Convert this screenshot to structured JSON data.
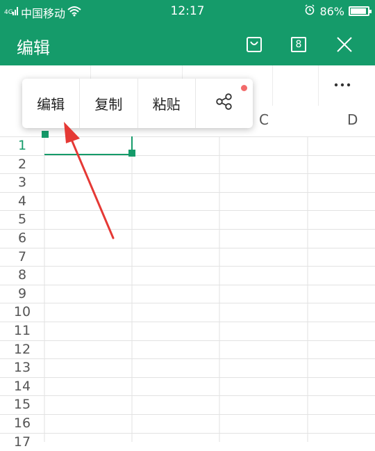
{
  "status_bar": {
    "carrier": "中国移动",
    "time": "12:17",
    "battery": "86%",
    "battery_level": 0.86
  },
  "header": {
    "title": "编辑",
    "page_count": "8"
  },
  "columns": [
    "C",
    "D"
  ],
  "rows": [
    "1",
    "2",
    "3",
    "4",
    "5",
    "6",
    "7",
    "8",
    "9",
    "10",
    "11",
    "12",
    "13",
    "14",
    "15",
    "16",
    "17"
  ],
  "active_row": "1",
  "context_menu": {
    "edit": "编辑",
    "copy": "复制",
    "paste": "粘贴"
  },
  "colors": {
    "accent": "#159b6a",
    "arrow": "#e53935",
    "notification_dot": "#f26b6b"
  }
}
